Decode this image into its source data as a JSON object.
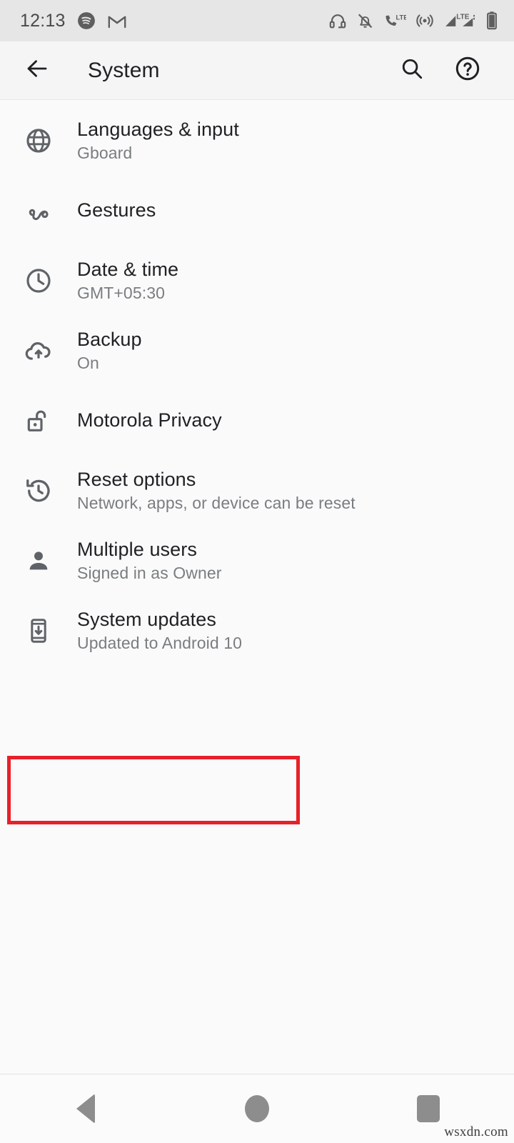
{
  "status_bar": {
    "time": "12:13",
    "left_icons": [
      "spotify-icon",
      "gmail-icon"
    ],
    "right_icons": [
      "headset-icon",
      "notifications-muted-icon",
      "volte-call-icon",
      "hotspot-icon",
      "signal-lte-icon",
      "signal-bars-icon",
      "battery-icon"
    ],
    "background_color": "#e6e6e6"
  },
  "app_bar": {
    "back_icon": "arrow-back-icon",
    "title": "System",
    "search_icon": "search-icon",
    "help_icon": "help-circle-icon",
    "background_color": "#f5f5f5"
  },
  "settings": {
    "items": [
      {
        "icon": "globe-icon",
        "title": "Languages & input",
        "subtitle": "Gboard",
        "highlighted": false
      },
      {
        "icon": "gesture-icon",
        "title": "Gestures",
        "subtitle": "",
        "highlighted": false
      },
      {
        "icon": "clock-icon",
        "title": "Date & time",
        "subtitle": "GMT+05:30",
        "highlighted": false
      },
      {
        "icon": "cloud-upload-icon",
        "title": "Backup",
        "subtitle": "On",
        "highlighted": false
      },
      {
        "icon": "lock-open-icon",
        "title": "Motorola Privacy",
        "subtitle": "",
        "highlighted": false
      },
      {
        "icon": "restore-icon",
        "title": "Reset options",
        "subtitle": "Network, apps, or device can be reset",
        "highlighted": false
      },
      {
        "icon": "person-icon",
        "title": "Multiple users",
        "subtitle": "Signed in as Owner",
        "highlighted": false
      },
      {
        "icon": "system-update-icon",
        "title": "System updates",
        "subtitle": "Updated to Android 10",
        "highlighted": true
      }
    ],
    "highlight_color": "#e8202a"
  },
  "nav_bar": {
    "back_icon": "nav-back-triangle-icon",
    "home_icon": "nav-home-circle-icon",
    "recents_icon": "nav-recents-square-icon"
  },
  "watermark": "wsxdn.com"
}
